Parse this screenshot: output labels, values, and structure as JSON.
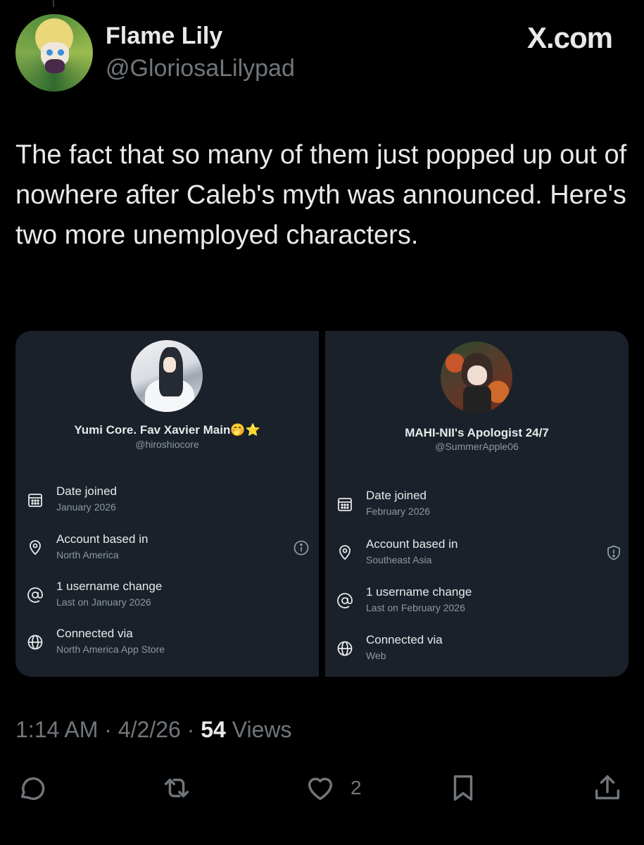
{
  "author": {
    "display_name": "Flame Lily",
    "handle": "@GloriosaLilypad"
  },
  "brand": "X.com",
  "tweet_text": "The fact that so many of them just popped up out of nowhere after Caleb's myth was announced. Here's two more unemployed characters.",
  "cards": [
    {
      "name": "Yumi Core. Fav Xavier Main🤭⭐",
      "handle": "@hiroshiocore",
      "rows": [
        {
          "icon": "calendar-icon",
          "label": "Date joined",
          "value": "January 2026"
        },
        {
          "icon": "location-pin-icon",
          "label": "Account based in",
          "value": "North America",
          "badge": "info-circle-icon"
        },
        {
          "icon": "at-sign-icon",
          "label": "1 username change",
          "value": "Last on January 2026"
        },
        {
          "icon": "globe-icon",
          "label": "Connected via",
          "value": "North America App Store"
        }
      ]
    },
    {
      "name": "MAHI-NII's Apologist 24/7",
      "handle": "@SummerApple06",
      "rows": [
        {
          "icon": "calendar-icon",
          "label": "Date joined",
          "value": "February 2026"
        },
        {
          "icon": "location-pin-icon",
          "label": "Account based in",
          "value": "Southeast Asia",
          "badge": "shield-alert-icon"
        },
        {
          "icon": "at-sign-icon",
          "label": "1 username change",
          "value": "Last on February 2026"
        },
        {
          "icon": "globe-icon",
          "label": "Connected via",
          "value": "Web"
        }
      ]
    }
  ],
  "meta": {
    "time": "1:14 AM",
    "sep": "·",
    "date": "4/2/26",
    "views_count": "54",
    "views_label": "Views"
  },
  "actions": {
    "reply": "reply-icon",
    "repost": "repost-icon",
    "like": "heart-icon",
    "like_count": "2",
    "bookmark": "bookmark-icon",
    "share": "share-icon"
  },
  "colors": {
    "background": "#000000",
    "card": "#1b212a",
    "text": "#e7e9ea",
    "secondary": "#71767b"
  }
}
